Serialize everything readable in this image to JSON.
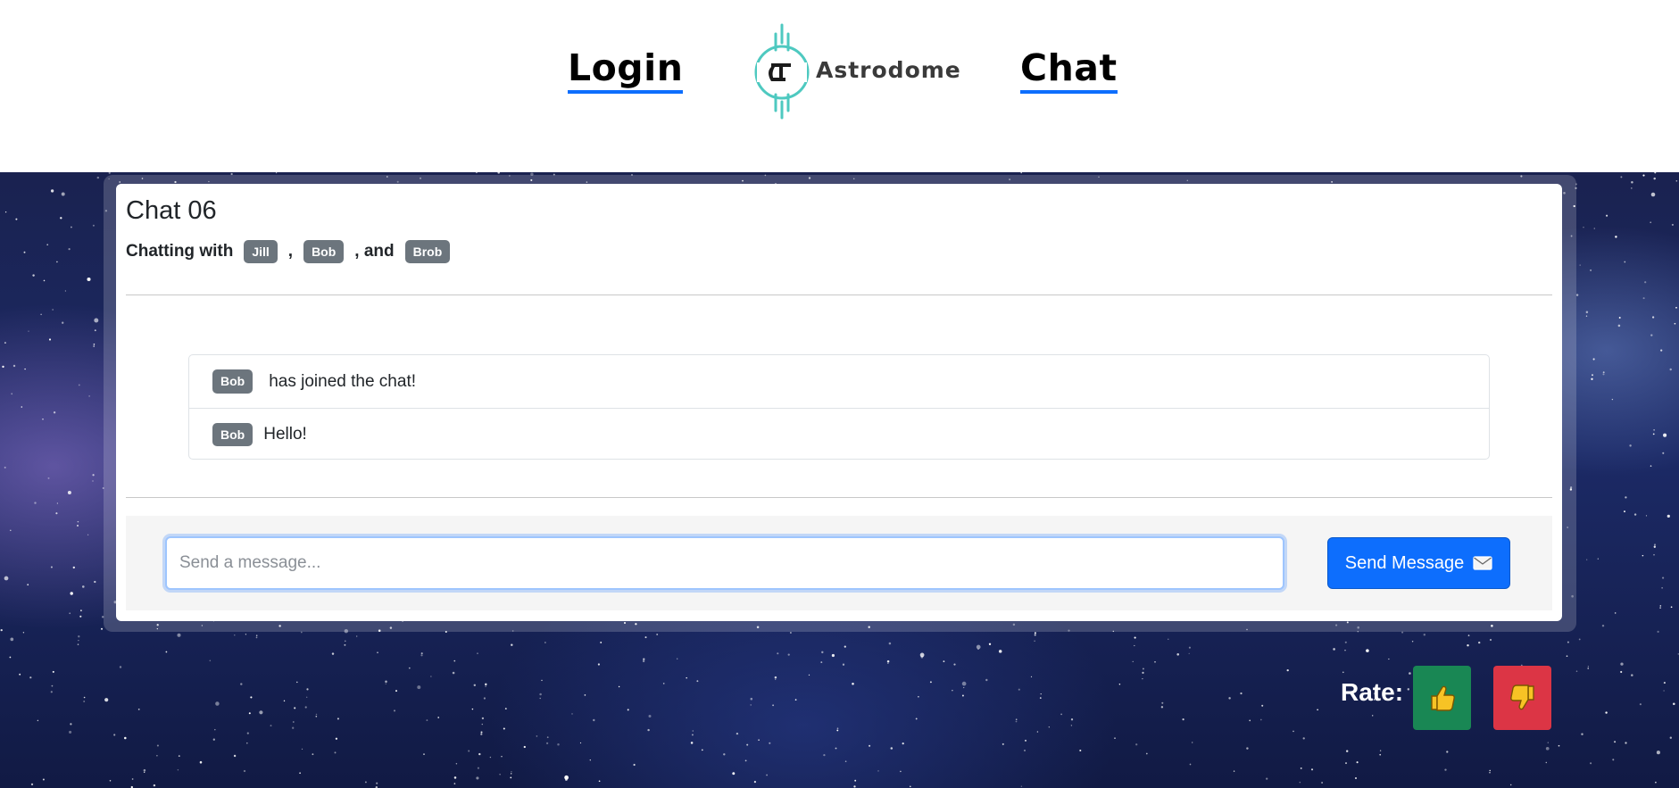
{
  "nav": {
    "login_label": "Login",
    "chat_label": "Chat",
    "logo_text": "Astrodome"
  },
  "chat": {
    "title": "Chat 06",
    "chatting_prefix": "Chatting with",
    "participants": [
      "Jill",
      "Bob",
      "Brob"
    ],
    "separator_comma": ",",
    "separator_and": ", and"
  },
  "messages": [
    {
      "user": "Bob",
      "text": "has joined the chat!"
    },
    {
      "user": "Bob",
      "text": "Hello!"
    }
  ],
  "composer": {
    "placeholder": "Send a message...",
    "value": "",
    "send_label": "Send Message",
    "send_icon": "envelope-icon"
  },
  "rating": {
    "label": "Rate:",
    "up_icon": "thumbs-up-icon",
    "down_icon": "thumbs-down-icon"
  },
  "colors": {
    "accent": "#0d6efd",
    "badge": "#6c757d",
    "success": "#198754",
    "danger": "#dc3545",
    "logo_teal": "#4ec9c0"
  }
}
